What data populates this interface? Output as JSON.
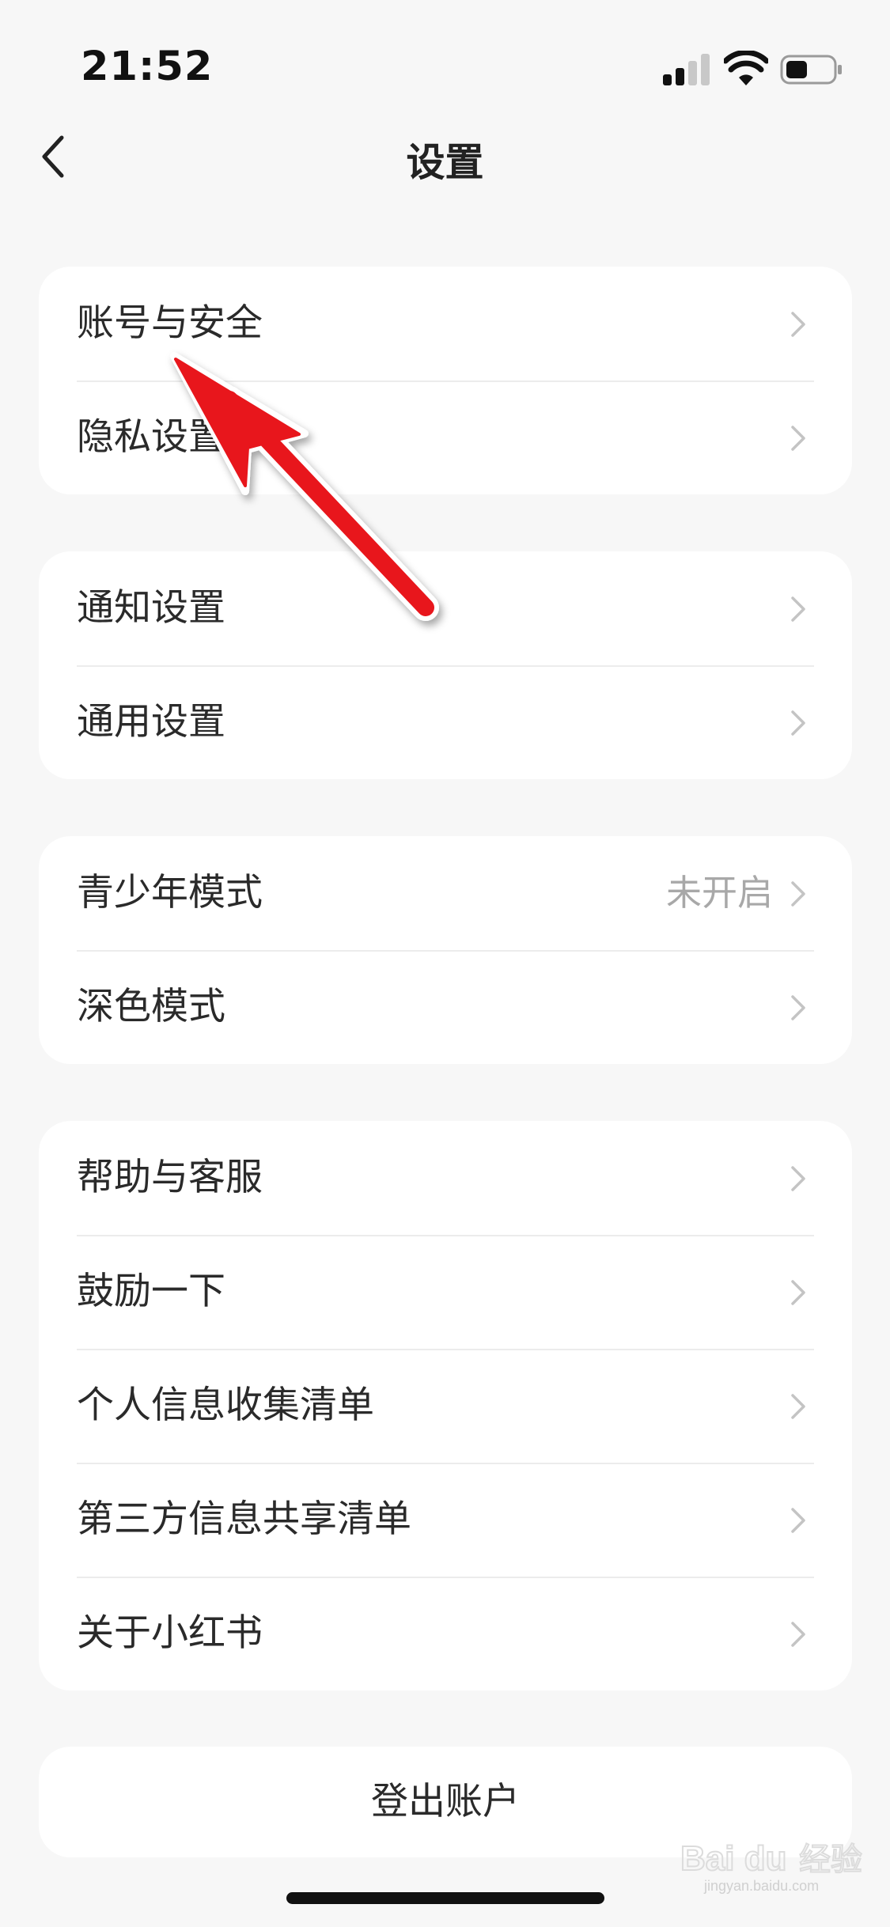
{
  "status_bar": {
    "time": "21:52"
  },
  "nav": {
    "title": "设置"
  },
  "groups": [
    {
      "items": [
        {
          "label": "账号与安全"
        },
        {
          "label": "隐私设置"
        }
      ]
    },
    {
      "items": [
        {
          "label": "通知设置"
        },
        {
          "label": "通用设置"
        }
      ]
    },
    {
      "items": [
        {
          "label": "青少年模式",
          "value": "未开启"
        },
        {
          "label": "深色模式"
        }
      ]
    },
    {
      "items": [
        {
          "label": "帮助与客服"
        },
        {
          "label": "鼓励一下"
        },
        {
          "label": "个人信息收集清单"
        },
        {
          "label": "第三方信息共享清单"
        },
        {
          "label": "关于小红书"
        }
      ]
    }
  ],
  "logout": {
    "label": "登出账户"
  },
  "annotation": {
    "arrow_color": "#e8141c",
    "points_to": "账号与安全"
  },
  "watermark": {
    "brand": "Bai du 经验",
    "url": "jingyan.baidu.com"
  },
  "colors": {
    "background": "#f7f7f7",
    "card": "#ffffff",
    "chevron": "#c4c4c4",
    "secondary_text": "#a8a8a8"
  }
}
